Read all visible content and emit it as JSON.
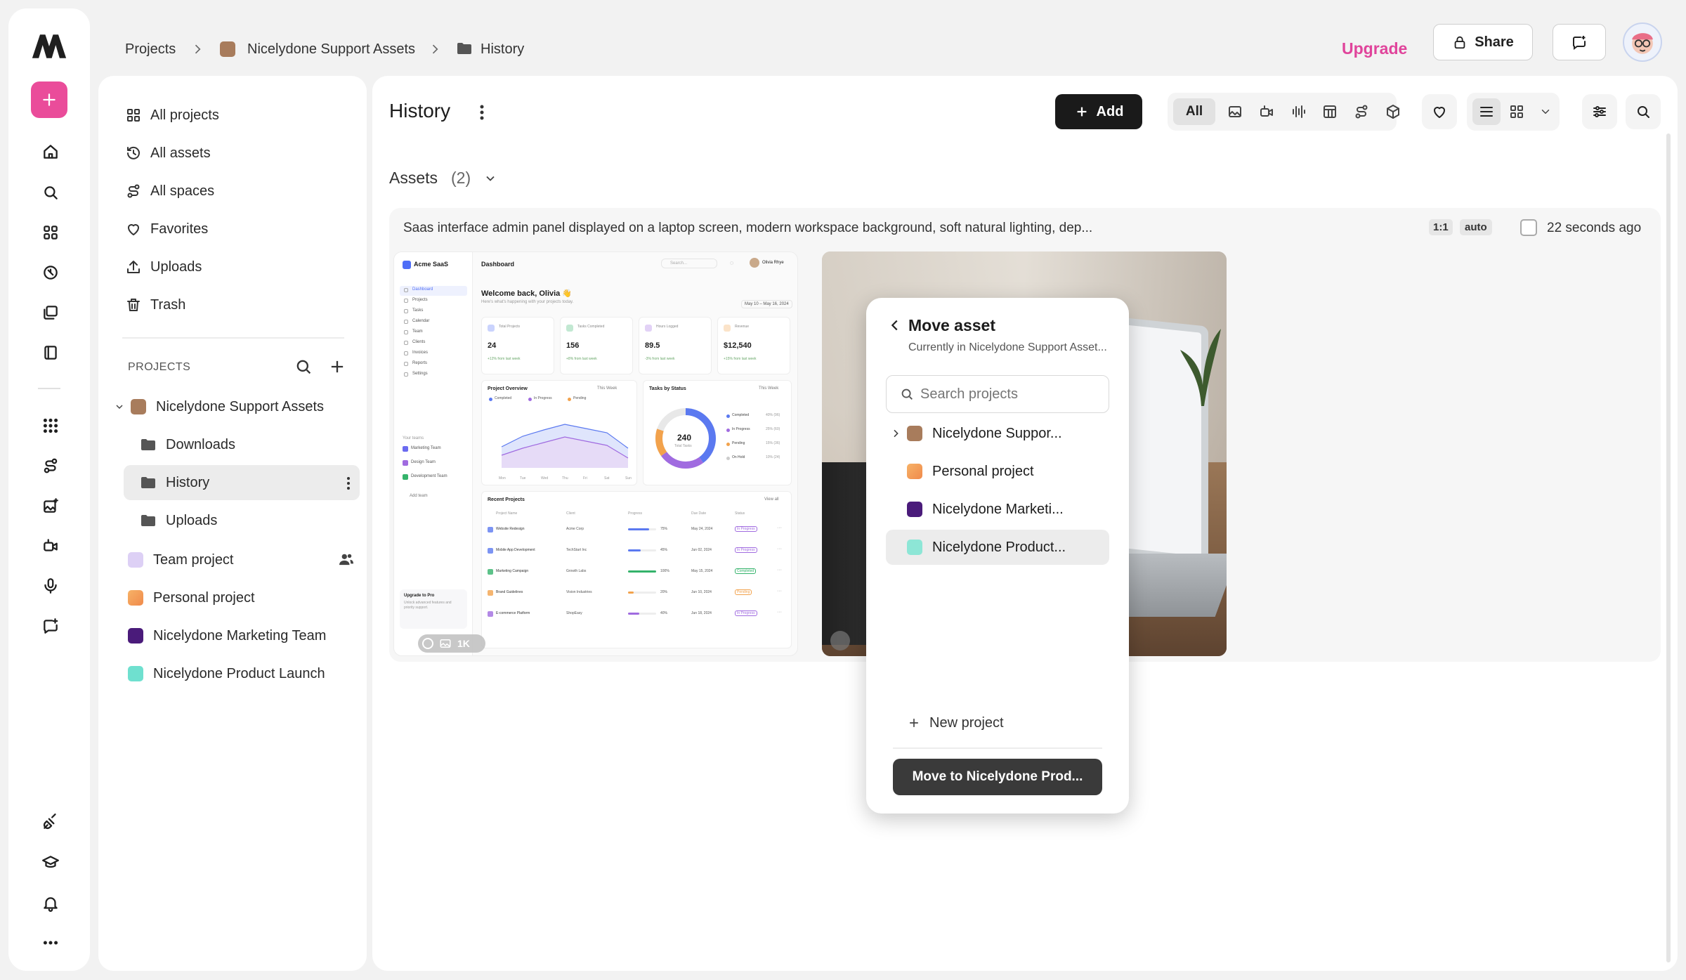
{
  "breadcrumb": {
    "items": [
      "Projects",
      "Nicelydone Support Assets",
      "History"
    ]
  },
  "header": {
    "upgrade": "Upgrade",
    "share": "Share"
  },
  "sidebar": {
    "nav": [
      {
        "label": "All projects",
        "icon": "grid-icon"
      },
      {
        "label": "All assets",
        "icon": "history-icon"
      },
      {
        "label": "All spaces",
        "icon": "spaces-icon"
      },
      {
        "label": "Favorites",
        "icon": "heart-icon"
      },
      {
        "label": "Uploads",
        "icon": "upload-icon"
      },
      {
        "label": "Trash",
        "icon": "trash-icon"
      }
    ],
    "projects_heading": "PROJECTS",
    "projects": {
      "support": "Nicelydone Support Assets",
      "folders": [
        "Downloads",
        "History",
        "Uploads"
      ],
      "team": "Team project",
      "personal": "Personal project",
      "marketing": "Nicelydone Marketing Team",
      "product": "Nicelydone Product Launch"
    },
    "colors": {
      "support": "#a87c5c",
      "team": "#ddd0f5",
      "personal": "#f2a65a",
      "marketing": "#4a1b7a",
      "product": "#6fe0cf"
    }
  },
  "main": {
    "title": "History",
    "add_label": "Add",
    "filter_all": "All",
    "assets_label": "Assets",
    "assets_count": "(2)",
    "prompt_text": "Saas interface admin panel displayed on a laptop screen, modern workspace background, soft natural lighting, dep...",
    "ratio_badge": "1:1",
    "auto_badge": "auto",
    "time_ago": "22 seconds ago",
    "thumb_badge": "1K"
  },
  "dashboard_preview": {
    "brand": "Acme SaaS",
    "header": "Dashboard",
    "search": "Search...",
    "user": "Olivia Rhye",
    "welcome": "Welcome back, Olivia 👋",
    "subtitle": "Here's what's happening with your projects today.",
    "date_range": "May 10 – May 16, 2024",
    "menu": [
      "Dashboard",
      "Projects",
      "Tasks",
      "Calendar",
      "Team",
      "Clients",
      "Invoices",
      "Reports",
      "Settings"
    ],
    "teams_heading": "Your teams",
    "teams": [
      "Marketing Team",
      "Design Team",
      "Development Team"
    ],
    "add_team": "Add team",
    "upgrade_title": "Upgrade to Pro",
    "upgrade_text": "Unlock advanced features and priority support.",
    "stats": [
      {
        "label": "Total Projects",
        "value": "24",
        "delta": "+12% from last week"
      },
      {
        "label": "Tasks Completed",
        "value": "156",
        "delta": "+8% from last week"
      },
      {
        "label": "Hours Logged",
        "value": "89.5",
        "delta": "-3% from last week"
      },
      {
        "label": "Revenue",
        "value": "$12,540",
        "delta": "+15% from last week"
      }
    ],
    "overview_title": "Project Overview",
    "this_week": "This Week",
    "legend": [
      "Completed",
      "In Progress",
      "Pending"
    ],
    "days": [
      "Mon",
      "Tue",
      "Wed",
      "Thu",
      "Fri",
      "Sat",
      "Sun"
    ],
    "tasks_title": "Tasks by Status",
    "donut_value": "240",
    "donut_label": "Total Tasks",
    "status_rows": [
      {
        "label": "Completed",
        "value": "40% (96)"
      },
      {
        "label": "In Progress",
        "value": "25% (60)"
      },
      {
        "label": "Pending",
        "value": "15% (36)"
      },
      {
        "label": "On Hold",
        "value": "10% (24)"
      }
    ],
    "recent_title": "Recent Projects",
    "view_all": "View all",
    "columns": [
      "Project Name",
      "Client",
      "Progress",
      "Due Date",
      "Status"
    ],
    "rows": [
      {
        "name": "Website Redesign",
        "client": "Acme Corp",
        "pct": "75%",
        "due": "May 24, 2024",
        "status": "In Progress"
      },
      {
        "name": "Mobile App Development",
        "client": "TechStart Inc",
        "pct": "45%",
        "due": "Jun 02, 2024",
        "status": "In Progress"
      },
      {
        "name": "Marketing Campaign",
        "client": "Growth Labs",
        "pct": "100%",
        "due": "May 15, 2024",
        "status": "Completed"
      },
      {
        "name": "Brand Guidelines",
        "client": "Vision Industries",
        "pct": "20%",
        "due": "Jun 10, 2024",
        "status": "Pending"
      },
      {
        "name": "E-commerce Platform",
        "client": "ShopEasy",
        "pct": "40%",
        "due": "Jun 18, 2024",
        "status": "In Progress"
      }
    ]
  },
  "popup": {
    "title": "Move asset",
    "subtitle": "Currently in Nicelydone Support Asset...",
    "search_placeholder": "Search projects",
    "projects": [
      "Nicelydone Suppor...",
      "Personal project",
      "Nicelydone Marketi...",
      "Nicelydone Product..."
    ],
    "new_project": "New project",
    "move_button": "Move to Nicelydone Prod..."
  }
}
